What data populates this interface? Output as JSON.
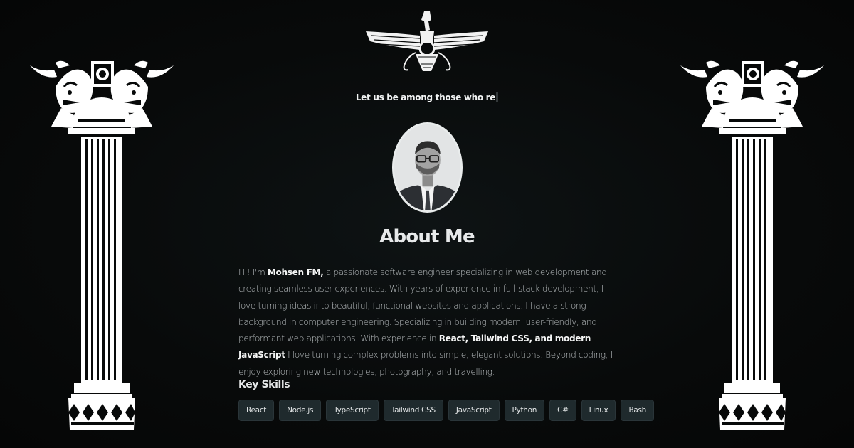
{
  "hero": {
    "typed_text": "Let us be among those who re"
  },
  "about": {
    "title": "About Me",
    "bio_1": "Hi! I'm ",
    "bio_name": "Mohsen FM,",
    "bio_2": " a passionate software engineer specializing in web development and creating seamless user experiences. With years of experience in full-stack development, I love turning ideas into beautiful, functional websites and applications. I have a strong background in computer engineering. Specializing in building modern, user-friendly, and performant web applications. With experience in ",
    "bio_stack": "React, Tailwind CSS, and modern JavaScript",
    "bio_3": " I love turning complex problems into simple, elegant solutions. Beyond coding, I enjoy exploring new technologies, photography, and travelling."
  },
  "skills": {
    "title": "Key Skills",
    "items": [
      "React",
      "Node.js",
      "TypeScript",
      "Tailwind CSS",
      "JavaScript",
      "Python",
      "C#",
      "Linux",
      "Bash"
    ]
  },
  "icons": {
    "left_pillar": "persian-column-icon",
    "right_pillar": "persian-column-icon",
    "top_emblem": "faravahar-icon",
    "profile": "profile-photo"
  },
  "colors": {
    "background": "#070909",
    "chip_bg": "#1f2a2d",
    "text": "#b9bec0",
    "heading": "#e7e9ea"
  }
}
